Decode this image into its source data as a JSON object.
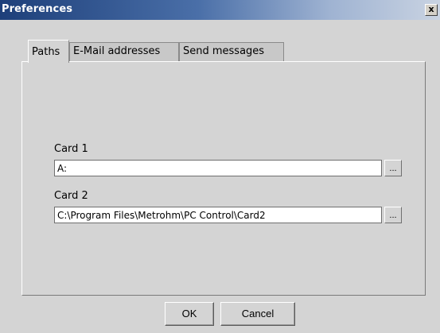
{
  "window": {
    "title": "Preferences",
    "close_label": "x"
  },
  "tabs": [
    {
      "label": "Paths",
      "active": true
    },
    {
      "label": "E-Mail addresses",
      "active": false
    },
    {
      "label": "Send messages",
      "active": false
    }
  ],
  "paths": {
    "card1": {
      "label": "Card 1",
      "value": "A:",
      "browse_label": "..."
    },
    "card2": {
      "label": "Card 2",
      "value": "C:\\Program Files\\Metrohm\\PC Control\\Card2",
      "browse_label": "..."
    }
  },
  "buttons": {
    "ok_label": "OK",
    "cancel_label": "Cancel"
  }
}
